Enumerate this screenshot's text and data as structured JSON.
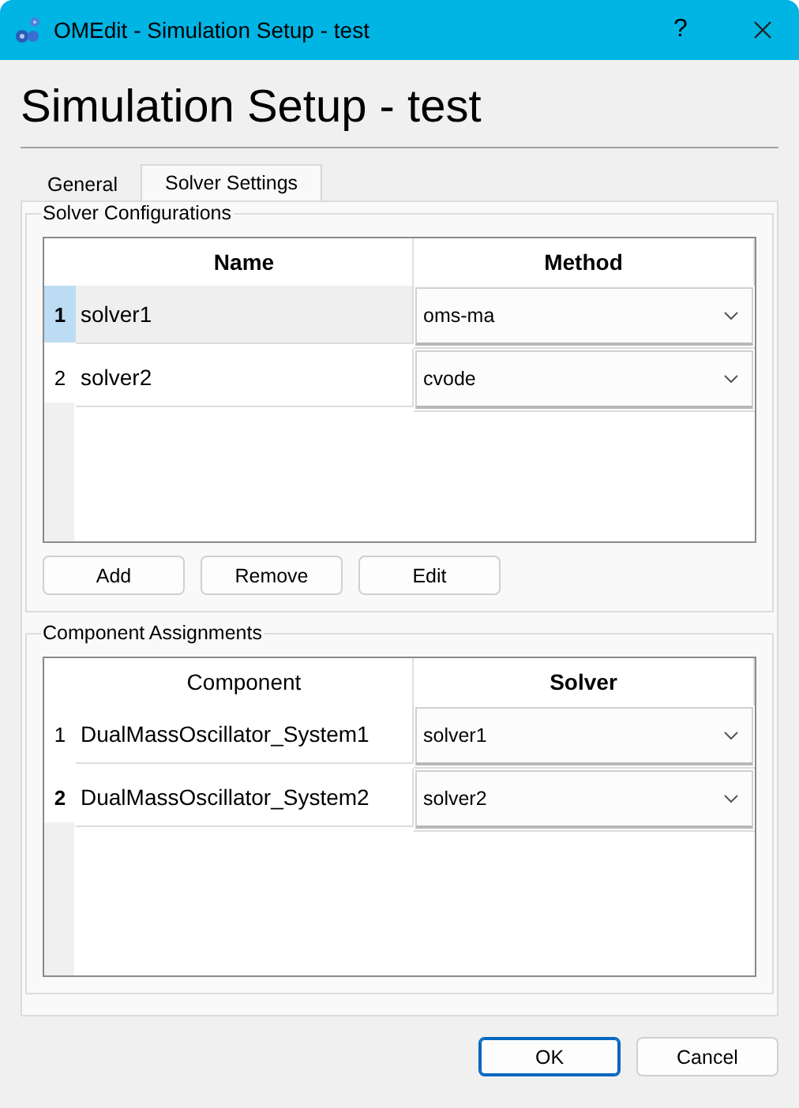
{
  "window": {
    "title": "OMEdit - Simulation Setup - test",
    "help": "?"
  },
  "heading": "Simulation Setup - test",
  "tabs": [
    {
      "label": "General",
      "selected": false
    },
    {
      "label": "Solver Settings",
      "selected": true
    }
  ],
  "solver_configurations": {
    "title": "Solver Configurations",
    "columns": [
      {
        "label": "Name",
        "current": true
      },
      {
        "label": "Method",
        "current": true
      }
    ],
    "rows": [
      {
        "number": "1",
        "name": "solver1",
        "value": "oms-ma",
        "selected": true,
        "current": true
      },
      {
        "number": "2",
        "name": "solver2",
        "value": "cvode",
        "selected": false,
        "current": false
      }
    ],
    "buttons": [
      "Add",
      "Remove",
      "Edit"
    ]
  },
  "component_assignments": {
    "title": "Component Assignments",
    "columns": [
      {
        "label": "Component",
        "current": false
      },
      {
        "label": "Solver",
        "current": true
      }
    ],
    "rows": [
      {
        "number": "1",
        "name": "DualMassOscillator_System1",
        "value": "solver1",
        "selected": false,
        "current": false
      },
      {
        "number": "2",
        "name": "DualMassOscillator_System2",
        "value": "solver2",
        "selected": false,
        "current": true
      }
    ]
  },
  "buttons": [
    {
      "label": "OK",
      "default": true
    },
    {
      "label": "Cancel",
      "default": false
    }
  ]
}
